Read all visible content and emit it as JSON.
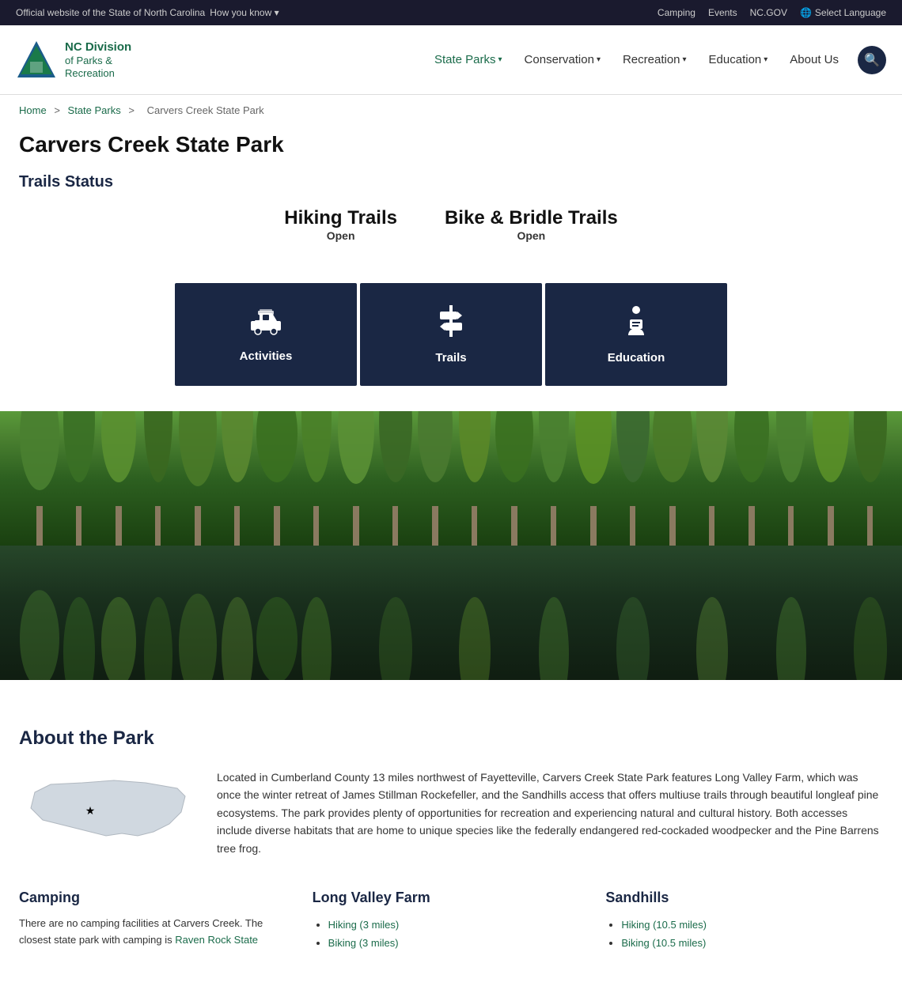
{
  "topbar": {
    "official_text": "Official website of the State of North Carolina",
    "how_you_know": "How you know",
    "camping": "Camping",
    "events": "Events",
    "nc_gov": "NC.GOV",
    "select_language": "Select Language"
  },
  "logo": {
    "line1": "NC Division",
    "line2": "of Parks &",
    "line3": "Recreation"
  },
  "nav": {
    "state_parks": "State Parks",
    "conservation": "Conservation",
    "recreation": "Recreation",
    "education": "Education",
    "about_us": "About Us"
  },
  "breadcrumb": {
    "home": "Home",
    "state_parks": "State Parks",
    "current": "Carvers Creek State Park"
  },
  "page": {
    "title": "Carvers Creek State Park",
    "trails_status_heading": "Trails Status",
    "hiking_trails": "Hiking Trails",
    "hiking_status": "Open",
    "bike_bridle": "Bike & Bridle Trails",
    "bike_status": "Open"
  },
  "cards": [
    {
      "icon": "🚙",
      "label": "Activities"
    },
    {
      "icon": "🪧",
      "label": "Trails"
    },
    {
      "icon": "📖",
      "label": "Education"
    }
  ],
  "about": {
    "heading": "About the Park",
    "description": "Located in Cumberland County 13 miles northwest of Fayetteville, Carvers Creek State Park features Long Valley Farm, which was once the winter retreat of James Stillman Rockefeller, and the Sandhills access that offers multiuse trails through beautiful longleaf pine ecosystems. The park provides plenty of opportunities for recreation and experiencing natural and cultural history. Both accesses include diverse habitats that are home to unique species like the federally endangered red-cockaded woodpecker and the Pine Barrens tree frog."
  },
  "camping": {
    "heading": "Camping",
    "text": "There are no camping facilities at Carvers Creek. The closest state park with camping is",
    "link_text": "Raven Rock State"
  },
  "long_valley": {
    "heading": "Long Valley Farm",
    "trails": [
      {
        "text": "Hiking (3 miles)",
        "href": "#"
      },
      {
        "text": "Biking (3 miles)",
        "href": "#"
      }
    ]
  },
  "sandhills": {
    "heading": "Sandhills",
    "trails": [
      {
        "text": "Hiking (10.5 miles)",
        "href": "#"
      },
      {
        "text": "Biking (10.5 miles)",
        "href": "#"
      }
    ]
  }
}
